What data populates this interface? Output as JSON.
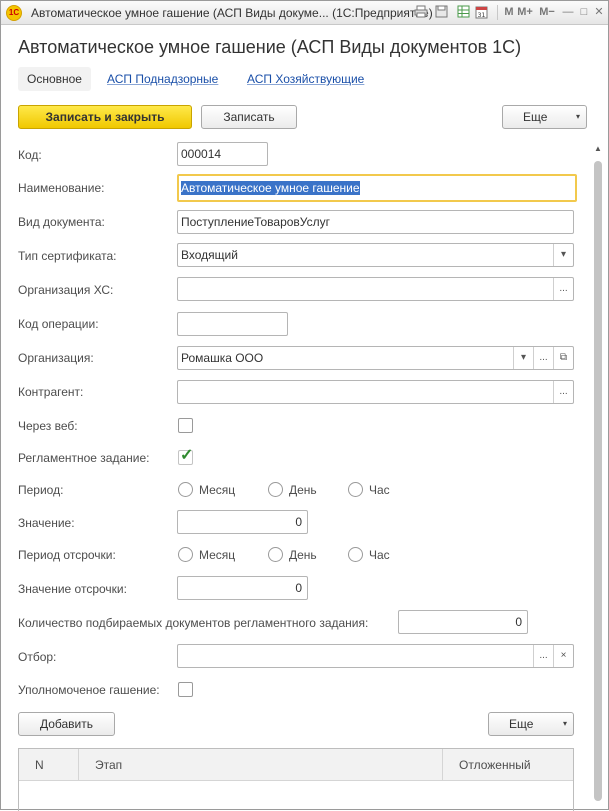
{
  "window": {
    "title": "Автоматическое умное гашение (АСП Виды докуме... (1С:Предприятие)",
    "logo_text": "1С",
    "icons": [
      "print-icon",
      "save-icon",
      "table-icon",
      "calendar-icon",
      "memory-icon",
      "memory-plus-icon",
      "memory-minus-icon",
      "minimize-icon",
      "maximize-icon",
      "close-icon"
    ],
    "icon_glyphs": {
      "memory": "M",
      "memory_plus": "M+",
      "memory_minus": "M−",
      "minimize": "—",
      "maximize": "□",
      "close": "✕"
    }
  },
  "form": {
    "title": "Автоматическое умное гашение (АСП Виды документов 1С)",
    "tabs": [
      "Основное",
      "АСП Поднадзорные",
      "АСП Хозяйствующие"
    ]
  },
  "toolbar": {
    "save_close": "Записать и закрыть",
    "save": "Записать",
    "more": "Еще"
  },
  "fields": {
    "code": {
      "label": "Код:",
      "value": "000014"
    },
    "name": {
      "label": "Наименование:",
      "value": "Автоматическое умное гашение"
    },
    "doc_type": {
      "label": "Вид документа:",
      "value": "ПоступлениеТоваровУслуг"
    },
    "cert_type": {
      "label": "Тип сертификата:",
      "value": "Входящий"
    },
    "org_hs": {
      "label": "Организация ХС:",
      "value": ""
    },
    "op_code": {
      "label": "Код операции:",
      "value": ""
    },
    "org": {
      "label": "Организация:",
      "value": "Ромашка ООО"
    },
    "counterparty": {
      "label": "Контрагент:",
      "value": ""
    },
    "via_web": {
      "label": "Через веб:",
      "checked": false
    },
    "scheduled": {
      "label": "Регламентное задание:",
      "checked": true
    },
    "period": {
      "label": "Период:",
      "options": [
        "Месяц",
        "День",
        "Час"
      ]
    },
    "value": {
      "label": "Значение:",
      "value": "0"
    },
    "delay_period": {
      "label": "Период отсрочки:",
      "options": [
        "Месяц",
        "День",
        "Час"
      ]
    },
    "delay_value": {
      "label": "Значение отсрочки:",
      "value": "0"
    },
    "doc_count": {
      "label": "Количество подбираемых документов регламентного задания:",
      "value": "0"
    },
    "filter": {
      "label": "Отбор:",
      "value": ""
    },
    "authorized": {
      "label": "Уполномоченое гашение:",
      "checked": false
    }
  },
  "table_toolbar": {
    "add": "Добавить",
    "more": "Еще"
  },
  "table": {
    "columns": [
      "N",
      "Этап",
      "Отложенный"
    ]
  },
  "glyphs": {
    "ellipsis": "...",
    "dropdown": "▾",
    "clear": "×",
    "open": "⧉",
    "check": "✓",
    "scroll_up": "▲"
  },
  "colors": {
    "accent_yellow": "#f0c800",
    "link": "#1a4fa8",
    "selection": "#3a73c8",
    "check_green": "#2f8a2f"
  }
}
